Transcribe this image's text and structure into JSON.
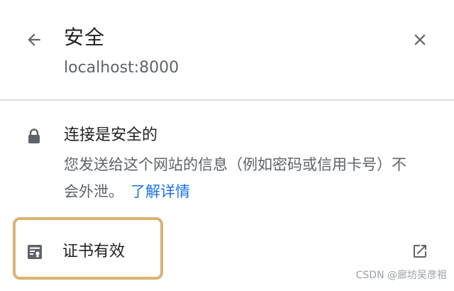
{
  "header": {
    "title": "安全",
    "site": "localhost:8000",
    "back_icon": "arrow-left-icon",
    "close_icon": "close-icon"
  },
  "connection": {
    "title": "连接是安全的",
    "description": "您发送给这个网站的信息（例如密码或信用卡号）不会外泄。",
    "learn_more": "了解详情",
    "icon": "lock-icon"
  },
  "certificate": {
    "label": "证书有效",
    "icon": "certificate-icon",
    "external_icon": "open-in-new-icon",
    "highlight_color": "#d9b470"
  },
  "watermark": {
    "text": "CSDN @廊坊吴彦祖"
  },
  "colors": {
    "primary_text": "#202124",
    "secondary_text": "#5f6368",
    "link": "#1a73e8",
    "divider": "#e0e0e0"
  }
}
